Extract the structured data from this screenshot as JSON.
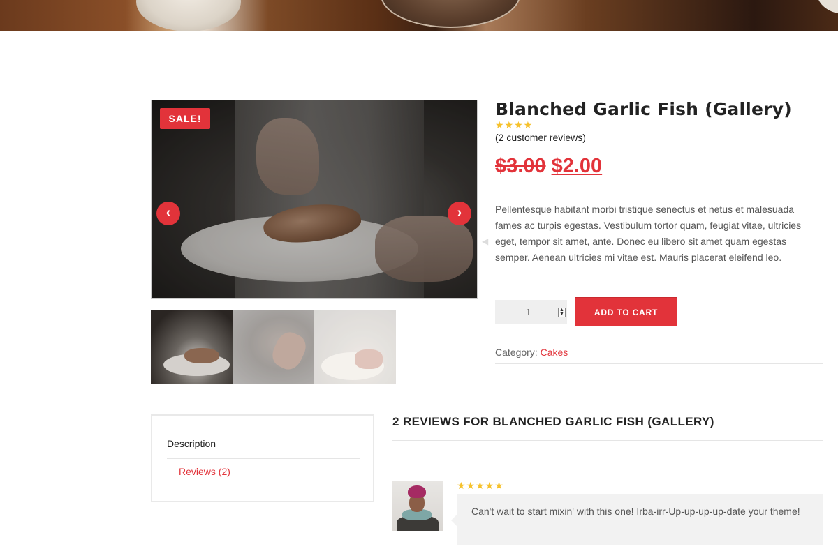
{
  "hero": {
    "image_name": "food-banner"
  },
  "gallery": {
    "sale_label": "SALE!",
    "prev_icon": "chevron-left-icon",
    "next_icon": "chevron-right-icon",
    "thumbnails": [
      "thumbnail-1",
      "thumbnail-2",
      "thumbnail-3"
    ]
  },
  "product": {
    "title": "Blanched Garlic Fish (Gallery)",
    "rating_stars": "★★★★",
    "review_count_text": "(2 customer reviews)",
    "old_price": "$3.00",
    "new_price": "$2.00",
    "description": "Pellentesque habitant morbi tristique senectus et netus et malesuada fames ac turpis egestas. Vestibulum tortor quam, feugiat vitae, ultricies eget, tempor sit amet, ante. Donec eu libero sit amet quam egestas semper. Aenean ultricies mi vitae est. Mauris placerat eleifend leo.",
    "quantity": "1",
    "add_to_cart_label": "ADD TO CART",
    "category_label": "Category:",
    "category_value": "Cakes"
  },
  "tabs": {
    "items": [
      {
        "label": "Description"
      },
      {
        "label": "Reviews (2)"
      }
    ]
  },
  "reviews": {
    "heading": "2 REVIEWS FOR BLANCHED GARLIC FISH (GALLERY)",
    "items": [
      {
        "stars": "★★★★★",
        "text": "Can't wait to start mixin' with this one! Irba-irr-Up-up-up-up-date your theme!"
      }
    ]
  },
  "colors": {
    "accent": "#e2333a",
    "star": "#f6c12b",
    "text": "#555555"
  }
}
